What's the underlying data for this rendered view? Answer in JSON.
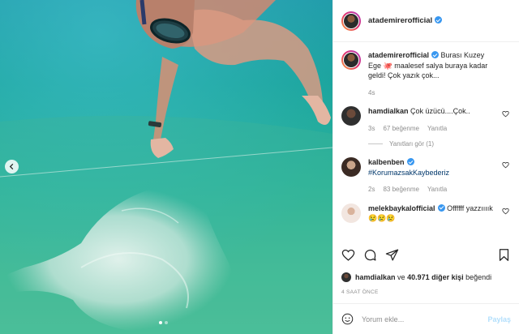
{
  "post": {
    "author": "atademirerofficial",
    "caption": "Burası Kuzey Ege 🐙 maalesef salya buraya kadar geldi! Çok yazık çok...",
    "caption_time": "4s"
  },
  "comments": [
    {
      "username": "hamdialkan",
      "text": "Çok üzücü....Çok..",
      "time": "3s",
      "likes": "67 beğenme",
      "reply": "Yanıtla",
      "view_replies": "Yanıtları gör (1)"
    },
    {
      "username": "kalbenben",
      "text": "#KorumazsakKaybederiz",
      "time": "2s",
      "likes": "83 beğenme",
      "reply": "Yanıtla"
    },
    {
      "username": "melekbaykalofficial",
      "text": "Offffff yazzıııık😢😢😢"
    }
  ],
  "likes_summary": {
    "user": "hamdialkan",
    "connector": "ve",
    "others": "40.971 diğer kişi",
    "suffix": "beğendi"
  },
  "time_ago": "4 SAAT ÖNCE",
  "comment_box": {
    "placeholder": "Yorum ekle...",
    "post_label": "Paylaş"
  },
  "icons": [
    "heart-icon",
    "comment-icon",
    "share-icon",
    "bookmark-icon",
    "emoji-icon",
    "chevron-left-icon"
  ],
  "colors": {
    "verified": "#3897f0",
    "link": "#00376b",
    "muted": "#8e8e8e",
    "post_disabled": "#b2dffc"
  }
}
